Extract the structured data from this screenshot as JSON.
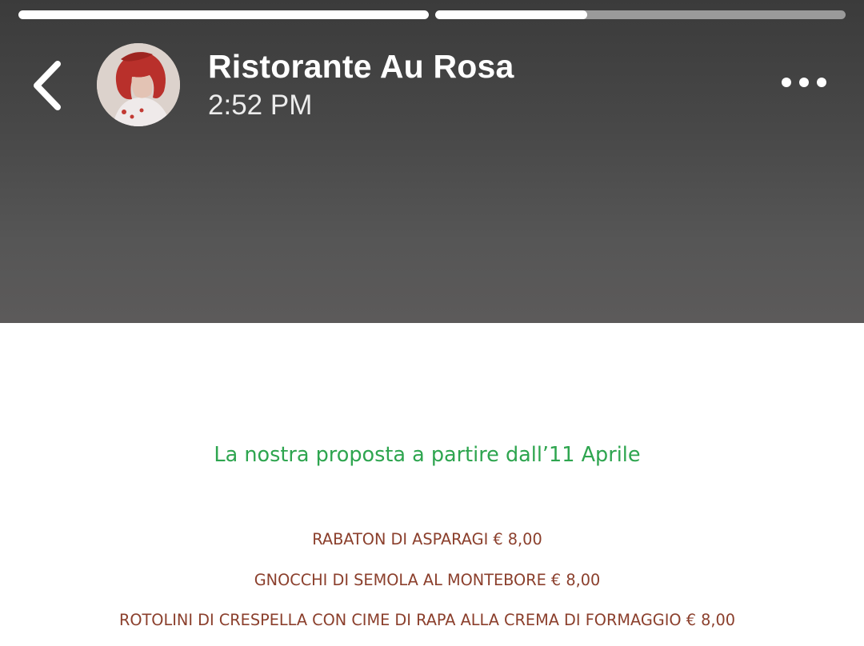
{
  "story": {
    "progress_segments": [
      {
        "fill_fraction": 1.0
      },
      {
        "fill_fraction": 0.37
      }
    ],
    "account_name": "Ristorante Au Rosa",
    "timestamp": "2:52 PM",
    "icons": {
      "back": "chevron-left-icon",
      "more": "more-horizontal-icon",
      "avatar": "profile-photo"
    }
  },
  "menu": {
    "heading": "La nostra proposta a partire dall’11 Aprile",
    "items": [
      "RABATON DI ASPARAGI  € 8,00",
      "GNOCCHI DI SEMOLA AL MONTEBORE  € 8,00",
      "ROTOLINI DI CRESPELLA CON CIME DI RAPA ALLA CREMA DI FORMAGGIO  € 8,00"
    ]
  },
  "colors": {
    "heading_green": "#2ea54f",
    "item_brown": "#8b3f2c",
    "header_bg": "#484848"
  }
}
